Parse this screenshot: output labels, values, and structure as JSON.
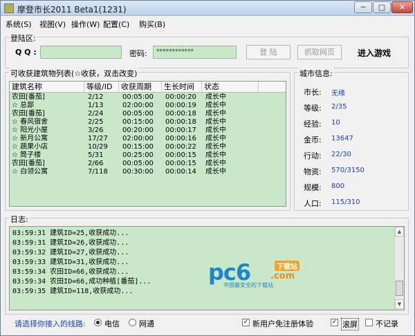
{
  "window": {
    "title": "摩登市长2011 Beta1(1231)",
    "min_label": "─",
    "max_label": "□",
    "close_label": "✕"
  },
  "menu": [
    "系统(S)",
    "视图(V)",
    "操作(W)",
    "配置(C)",
    "购买(B)"
  ],
  "login": {
    "legend": "登陆区:",
    "qq_label": "Q Q :",
    "qq_value": "",
    "password_label": "密码:",
    "password_value": "************",
    "login_button": "登 陆",
    "fetch_button": "抓取网页",
    "enter_game": "进入游戏"
  },
  "buildings": {
    "legend": "可收获建筑物列表(☆收获，双击改变)",
    "columns": [
      "建筑名称",
      "等级/ID",
      "收获周期",
      "生长时间",
      "状态"
    ],
    "rows": [
      [
        "农田[番茄]",
        "2/12",
        "00:05:00",
        "00:00:20",
        "成长中"
      ],
      [
        "☆ 总部",
        "1/13",
        "02:00:00",
        "00:00:19",
        "成长中"
      ],
      [
        "农田[番茄]",
        "2/24",
        "00:05:00",
        "00:00:18",
        "成长中"
      ],
      [
        "☆ 春风宿舍",
        "2/25",
        "00:15:00",
        "00:00:18",
        "成长中"
      ],
      [
        "☆ 阳光小屋",
        "3/26",
        "00:20:00",
        "00:00:17",
        "成长中"
      ],
      [
        "☆ 新月公寓",
        "17/27",
        "02:00:00",
        "00:00:16",
        "成长中"
      ],
      [
        "☆ 蔬果小店",
        "10/29",
        "00:15:00",
        "00:00:22",
        "成长中"
      ],
      [
        "☆ 筒子楼",
        "5/31",
        "00:25:00",
        "00:00:15",
        "成长中"
      ],
      [
        "农田[番茄]",
        "2/66",
        "00:05:00",
        "00:00:15",
        "成长中"
      ],
      [
        "☆ 白领公寓",
        "7/118",
        "00:30:00",
        "00:00:14",
        "成长中"
      ]
    ]
  },
  "city": {
    "legend": "城市信息:",
    "items": [
      {
        "label": "市长:",
        "value": "无缘"
      },
      {
        "label": "等级:",
        "value": "2/35"
      },
      {
        "label": "经验:",
        "value": "10"
      },
      {
        "label": "金币:",
        "value": "13647"
      },
      {
        "label": "行动:",
        "value": "22/30"
      },
      {
        "label": "物资:",
        "value": "570/3150"
      },
      {
        "label": "规模:",
        "value": "800"
      },
      {
        "label": "人口:",
        "value": "115/310"
      }
    ]
  },
  "log": {
    "legend": "日志:",
    "lines": [
      "03:59:31 建筑ID=25,收获成功...",
      "03:59:31 建筑ID=26,收获成功...",
      "03:59:32 建筑ID=27,收获成功...",
      "03:59:33 建筑ID=31,收获成功...",
      "03:59:34 农田ID=66,收获成功...",
      "03:59:34 农田ID=66,成功种植[番茄]...",
      "03:59:35 建筑ID=118,收获成功..."
    ]
  },
  "watermark": {
    "brand": "pc6",
    "tag": "下载站",
    "domain": ".com",
    "slogan": "中国最安全的下载站"
  },
  "status": {
    "line_label": "请选择你接入的线路:",
    "option_telecom": "电信",
    "option_netcom": "网通",
    "telecom_selected": true,
    "register_label": "新用户免注册体验",
    "register_checked": true,
    "scroll_label": "滚屏",
    "scroll_checked": true,
    "norecord_label": "不记录",
    "norecord_checked": false
  }
}
